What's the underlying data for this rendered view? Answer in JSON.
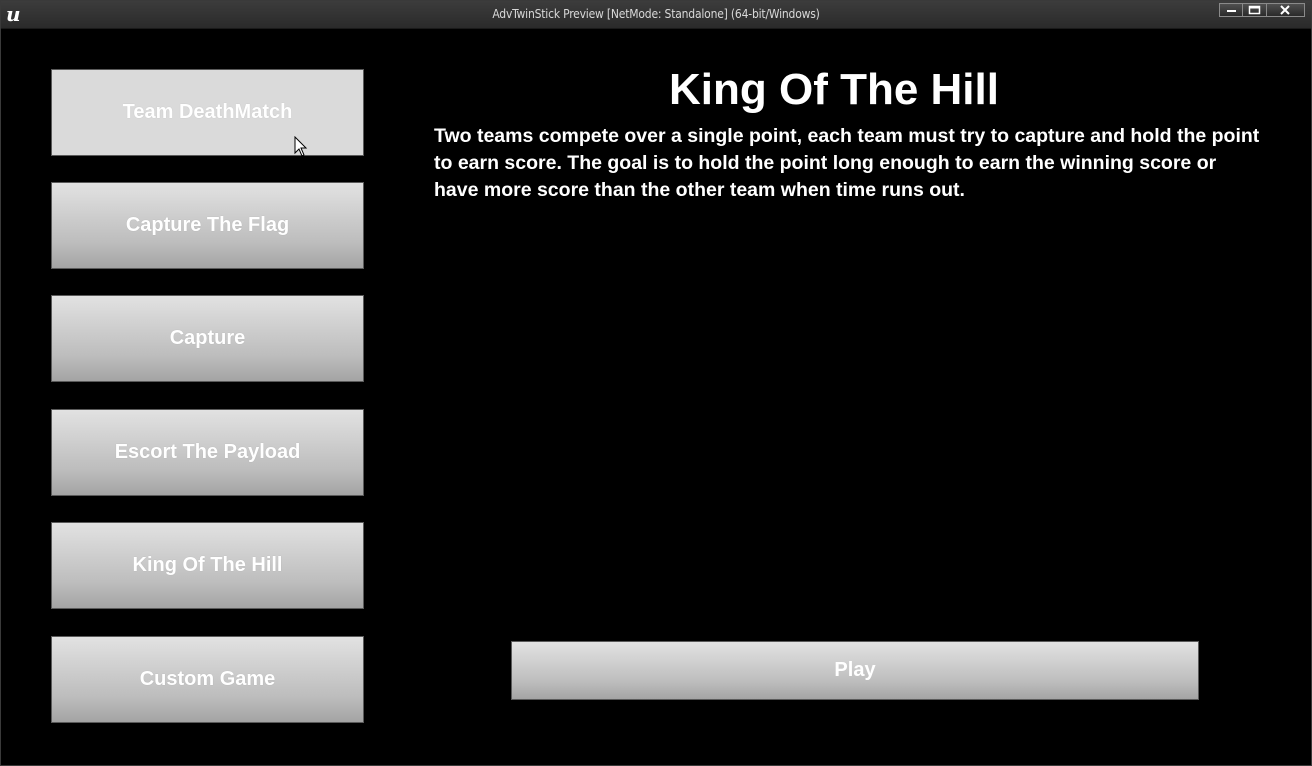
{
  "window": {
    "title": "AdvTwinStick Preview [NetMode: Standalone] (64-bit/Windows)",
    "logo_icon": "unreal-engine-logo"
  },
  "game_modes": [
    {
      "label": "Team DeathMatch",
      "state": "hovered"
    },
    {
      "label": "Capture The Flag",
      "state": "normal"
    },
    {
      "label": "Capture",
      "state": "normal"
    },
    {
      "label": "Escort The Payload",
      "state": "normal"
    },
    {
      "label": "King Of The Hill",
      "state": "normal"
    },
    {
      "label": "Custom Game",
      "state": "normal"
    }
  ],
  "selected_mode": {
    "title": "King Of The Hill",
    "description": "Two teams compete over a single point, each team must try to capture and hold the point to earn score. The goal is to hold the point long enough to earn the winning score or have more score than the other team when time runs out."
  },
  "play_button": {
    "label": "Play"
  },
  "colors": {
    "background": "#000000",
    "button_top": "#e2e2e2",
    "button_bottom": "#a4a4a4",
    "text": "#ffffff"
  }
}
